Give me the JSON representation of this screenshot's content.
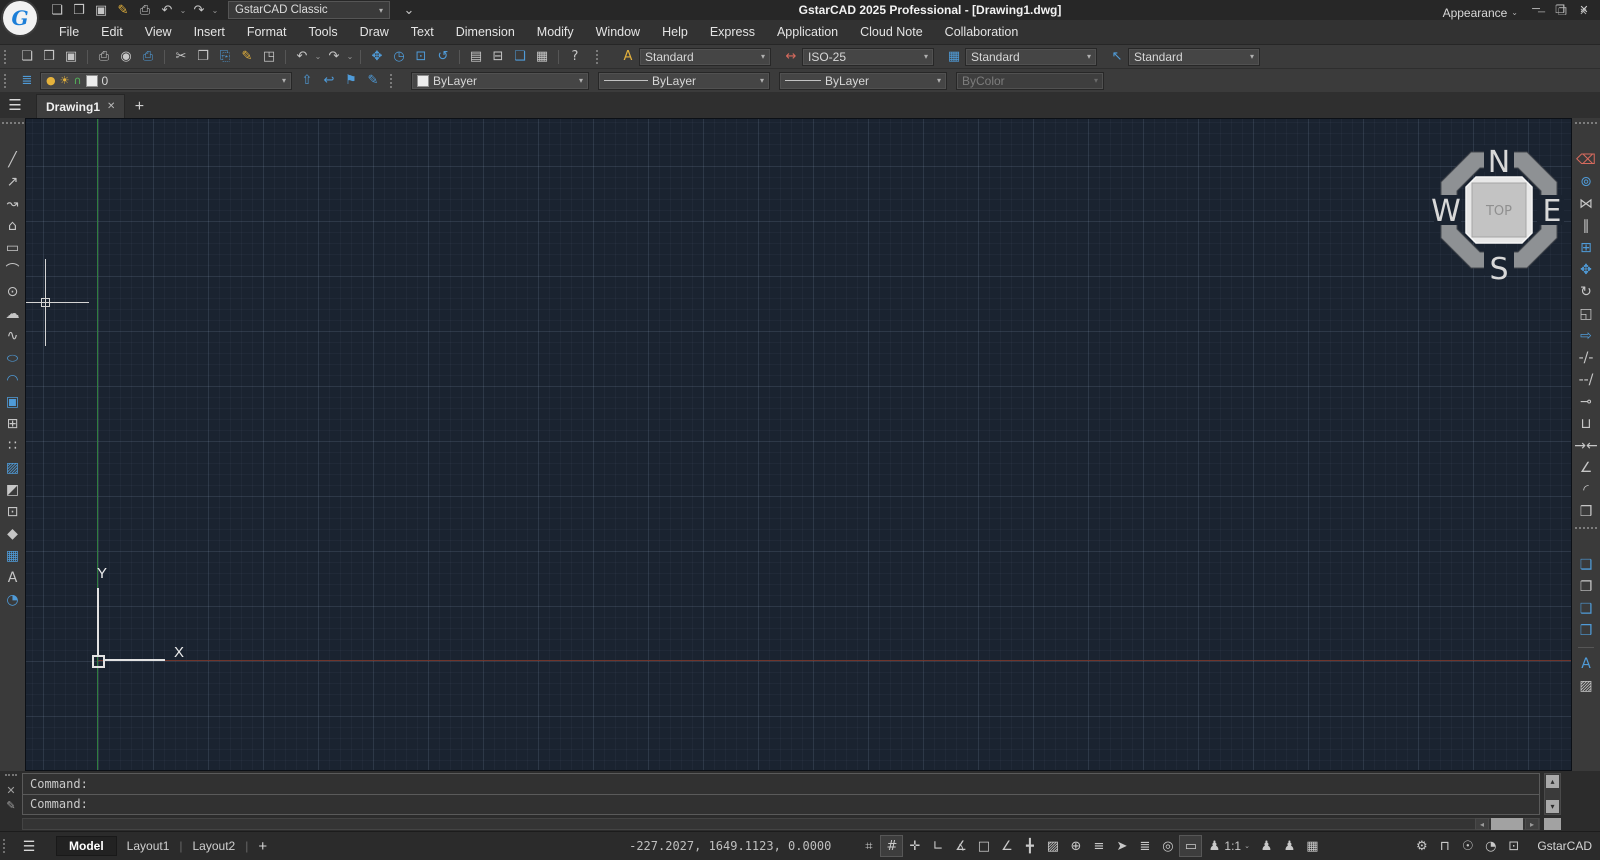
{
  "ui": {
    "caret": "▾",
    "caret_small": "⌄",
    "pipe": "|",
    "close": "✕",
    "add": "+",
    "hamburger": "☰",
    "left_arrow": "◂",
    "right_arrow": "▸",
    "up_arrow": "▴",
    "down_arrow": "▾"
  },
  "window": {
    "logo": "G",
    "title": "GstarCAD 2025 Professional - [Drawing1.dwg]",
    "controls": {
      "minimize": "─",
      "restore": "❐",
      "close": "✕"
    }
  },
  "quick_access": {
    "icons": [
      {
        "name": "new-file-icon",
        "glyph": "❏"
      },
      {
        "name": "open-file-icon",
        "glyph": "❒"
      },
      {
        "name": "save-icon",
        "glyph": "▣"
      },
      {
        "name": "save-as-icon",
        "glyph": "✎",
        "cls": "c-y"
      },
      {
        "name": "print-icon",
        "glyph": "⎙"
      },
      {
        "name": "undo-icon",
        "glyph": "↶"
      },
      {
        "name": "undo-dropdown-icon",
        "glyph": "⌄",
        "cls": "caret-ico"
      },
      {
        "name": "redo-icon",
        "glyph": "↷"
      },
      {
        "name": "redo-dropdown-icon",
        "glyph": "⌄",
        "cls": "caret-ico"
      }
    ],
    "workspace": "GstarCAD Classic",
    "overflow_glyph": "⌄"
  },
  "menu": {
    "items": [
      {
        "name": "menu-file",
        "label": "File"
      },
      {
        "name": "menu-edit",
        "label": "Edit"
      },
      {
        "name": "menu-view",
        "label": "View"
      },
      {
        "name": "menu-insert",
        "label": "Insert"
      },
      {
        "name": "menu-format",
        "label": "Format"
      },
      {
        "name": "menu-tools",
        "label": "Tools"
      },
      {
        "name": "menu-draw",
        "label": "Draw"
      },
      {
        "name": "menu-text",
        "label": "Text"
      },
      {
        "name": "menu-dimension",
        "label": "Dimension"
      },
      {
        "name": "menu-modify",
        "label": "Modify"
      },
      {
        "name": "menu-window",
        "label": "Window"
      },
      {
        "name": "menu-help",
        "label": "Help"
      },
      {
        "name": "menu-express",
        "label": "Express"
      },
      {
        "name": "menu-application",
        "label": "Application"
      },
      {
        "name": "menu-cloud-note",
        "label": "Cloud Note"
      },
      {
        "name": "menu-collaboration",
        "label": "Collaboration"
      }
    ],
    "appearance": "Appearance"
  },
  "toolbar_standard": {
    "icons": [
      {
        "name": "new-file-icon",
        "glyph": "❏"
      },
      {
        "name": "open-file-icon",
        "glyph": "❒"
      },
      {
        "name": "save-icon",
        "glyph": "▣"
      },
      {
        "name": "print-icon",
        "glyph": "⎙",
        "cls": "sb"
      },
      {
        "name": "print-preview-icon",
        "glyph": "◉"
      },
      {
        "name": "plot-icon",
        "glyph": "⎙",
        "cls": "c-b"
      },
      {
        "name": "cut-icon",
        "glyph": "✂",
        "cls": "sb"
      },
      {
        "name": "copy-icon",
        "glyph": "❐"
      },
      {
        "name": "paste-icon",
        "glyph": "⎘",
        "cls": "c-b"
      },
      {
        "name": "match-properties-icon",
        "glyph": "✎",
        "cls": "c-y"
      },
      {
        "name": "block-editor-icon",
        "glyph": "◳"
      },
      {
        "name": "undo-icon",
        "glyph": "↶",
        "cls": "sb"
      },
      {
        "name": "undo-dropdown-icon",
        "glyph": "⌄",
        "cls": "caret-ico"
      },
      {
        "name": "redo-icon",
        "glyph": "↷"
      },
      {
        "name": "redo-dropdown-icon",
        "glyph": "⌄",
        "cls": "caret-ico"
      },
      {
        "name": "pan-icon",
        "glyph": "✥",
        "cls": "sb c-b"
      },
      {
        "name": "zoom-realtime-icon",
        "glyph": "◷",
        "cls": "c-b"
      },
      {
        "name": "zoom-window-icon",
        "glyph": "⊡",
        "cls": "c-b"
      },
      {
        "name": "zoom-previous-icon",
        "glyph": "↺",
        "cls": "c-b"
      },
      {
        "name": "properties-palette-icon",
        "glyph": "▤",
        "cls": "sb"
      },
      {
        "name": "design-center-icon",
        "glyph": "⊟"
      },
      {
        "name": "toolbox-icon",
        "glyph": "❑",
        "cls": "c-b"
      },
      {
        "name": "calculator-icon",
        "glyph": "▦"
      },
      {
        "name": "help-icon",
        "glyph": "?",
        "cls": "sb"
      }
    ]
  },
  "style_combos": {
    "combos": [
      {
        "name": "text-style-combo",
        "icon": "A",
        "icls": "c-y",
        "value": "Standard"
      },
      {
        "name": "dimension-style-combo",
        "icon": "↔",
        "icls": "c-r",
        "value": "ISO-25"
      },
      {
        "name": "table-style-combo",
        "icon": "▦",
        "icls": "c-b",
        "value": "Standard"
      },
      {
        "name": "multileader-style-combo",
        "icon": "↖",
        "icls": "c-b",
        "value": "Standard"
      }
    ]
  },
  "layers": {
    "panel_icon": "≣",
    "bulb": "●",
    "sun": "☀",
    "lock": "∩",
    "current": "0",
    "tools": [
      {
        "name": "make-object-layer-current-icon",
        "glyph": "⇧",
        "cls": "c-b"
      },
      {
        "name": "layer-previous-icon",
        "glyph": "↩",
        "cls": "c-b"
      },
      {
        "name": "layer-states-icon",
        "glyph": "⚑",
        "cls": "c-b"
      },
      {
        "name": "change-to-current-layer-icon",
        "glyph": "✎",
        "cls": "c-b"
      }
    ]
  },
  "properties_toolbar": {
    "color_value": "ByLayer",
    "linetype_value": "ByLayer",
    "lineweight_value": "ByLayer",
    "plotstyle_value": "ByColor"
  },
  "tab_bar": {
    "tabs": [
      {
        "name": "tab-drawing1",
        "label": "Drawing1"
      }
    ]
  },
  "draw_toolbar": {
    "icons": [
      {
        "name": "toolbar-grip",
        "glyph": "",
        "cls": "vgrip"
      },
      {
        "name": "line-icon",
        "glyph": "╱"
      },
      {
        "name": "construction-line-icon",
        "glyph": "↗"
      },
      {
        "name": "polyline-icon",
        "glyph": "↝"
      },
      {
        "name": "polygon-icon",
        "glyph": "⌂"
      },
      {
        "name": "rectangle-icon",
        "glyph": "▭"
      },
      {
        "name": "arc-icon",
        "glyph": "⌒"
      },
      {
        "name": "circle-icon",
        "glyph": "⊙"
      },
      {
        "name": "revision-cloud-icon",
        "glyph": "☁"
      },
      {
        "name": "spline-icon",
        "glyph": "∿"
      },
      {
        "name": "ellipse-icon",
        "glyph": "○",
        "cls": "c-b flat"
      },
      {
        "name": "ellipse-arc-icon",
        "glyph": "◠",
        "cls": "c-b"
      },
      {
        "name": "insert-block-icon",
        "glyph": "▣",
        "cls": "c-b"
      },
      {
        "name": "make-block-icon",
        "glyph": "⊞"
      },
      {
        "name": "point-icon",
        "glyph": "∷"
      },
      {
        "name": "hatch-icon",
        "glyph": "▨",
        "cls": "c-b"
      },
      {
        "name": "gradient-icon",
        "glyph": "◩"
      },
      {
        "name": "region-icon",
        "glyph": "⊡"
      },
      {
        "name": "wipeout-icon",
        "glyph": "◆"
      },
      {
        "name": "table-icon",
        "glyph": "▦",
        "cls": "c-b"
      },
      {
        "name": "multiline-text-icon",
        "glyph": "A"
      },
      {
        "name": "divide-icon",
        "glyph": "◔",
        "cls": "c-b"
      }
    ]
  },
  "modify_toolbar": {
    "icons": [
      {
        "name": "toolbar-grip",
        "glyph": "",
        "cls": "vgrip"
      },
      {
        "name": "erase-icon",
        "glyph": "⌫",
        "cls": "c-r"
      },
      {
        "name": "copy-object-icon",
        "glyph": "⊚",
        "cls": "c-b"
      },
      {
        "name": "mirror-icon",
        "glyph": "⋈"
      },
      {
        "name": "offset-icon",
        "glyph": "∥"
      },
      {
        "name": "array-icon",
        "glyph": "⊞",
        "cls": "c-b"
      },
      {
        "name": "move-icon",
        "glyph": "✥",
        "cls": "c-b"
      },
      {
        "name": "rotate-icon",
        "glyph": "↻"
      },
      {
        "name": "scale-icon",
        "glyph": "◱"
      },
      {
        "name": "stretch-icon",
        "glyph": "⇨",
        "cls": "c-b"
      },
      {
        "name": "trim-icon",
        "glyph": "-/-"
      },
      {
        "name": "extend-icon",
        "glyph": "--/"
      },
      {
        "name": "break-at-point-icon",
        "glyph": "⊸"
      },
      {
        "name": "break-icon",
        "glyph": "⊔"
      },
      {
        "name": "join-icon",
        "glyph": "→←"
      },
      {
        "name": "chamfer-icon",
        "glyph": "∠"
      },
      {
        "name": "fillet-icon",
        "glyph": "◜"
      },
      {
        "name": "explode-icon",
        "glyph": "❒"
      },
      {
        "name": "toolbar-grip",
        "glyph": "",
        "cls": "vgrip"
      },
      {
        "name": "bring-to-front-icon",
        "glyph": "❏",
        "cls": "c-b"
      },
      {
        "name": "send-to-back-icon",
        "glyph": "❐"
      },
      {
        "name": "bring-above-objects-icon",
        "glyph": "❑",
        "cls": "c-b"
      },
      {
        "name": "send-under-objects-icon",
        "glyph": "❒",
        "cls": "c-b"
      },
      {
        "name": "text-to-front-icon",
        "glyph": "A",
        "cls": "st c-b"
      },
      {
        "name": "hatch-to-back-icon",
        "glyph": "▨"
      }
    ]
  },
  "canvas": {
    "compass": {
      "n": "N",
      "e": "E",
      "s": "S",
      "w": "W",
      "top": "TOP"
    },
    "ucs": {
      "x_label": "X",
      "y_label": "Y"
    },
    "colors": {
      "background": "#1a2330",
      "x_axis": "#6e352c",
      "y_axis": "#2f7d3f"
    }
  },
  "command": {
    "history": "Command:",
    "input": "Command:"
  },
  "status_bar": {
    "model_tab": "Model",
    "layouts": [
      {
        "name": "layout1-tab",
        "label": "Layout1"
      },
      {
        "name": "layout2-tab",
        "label": "Layout2"
      }
    ],
    "coordinates": "-227.2027, 1649.1123, 0.0000",
    "toggle_icons": [
      {
        "name": "snap-mode-icon",
        "glyph": "⌗"
      },
      {
        "name": "grid-display-icon",
        "glyph": "#",
        "cls": "pressed"
      },
      {
        "name": "entity-snap-icon",
        "glyph": "✛"
      },
      {
        "name": "ortho-mode-icon",
        "glyph": "∟"
      },
      {
        "name": "polar-tracking-icon",
        "glyph": "∡"
      },
      {
        "name": "object-snap-icon",
        "glyph": "□"
      },
      {
        "name": "object-snap-tracking-icon",
        "glyph": "∠"
      },
      {
        "name": "dynamic-ucs-icon",
        "glyph": "╋"
      },
      {
        "name": "show-hatch-icon",
        "glyph": "▨"
      },
      {
        "name": "dynamic-input-icon",
        "glyph": "⊕"
      },
      {
        "name": "show-lineweight-icon",
        "glyph": "≡",
        "cls": "c-b"
      },
      {
        "name": "selection-cycling-icon",
        "glyph": "➤"
      },
      {
        "name": "isolate-objects-icon",
        "glyph": "≣"
      },
      {
        "name": "quick-zoom-icon",
        "glyph": "◎",
        "cls": "c-b"
      },
      {
        "name": "workspace-switch-icon",
        "glyph": "▭",
        "cls": "pressed c-b"
      }
    ],
    "annotation_scale": "1:1",
    "annotation_person_glyph": "♟",
    "annotation_icons": [
      {
        "name": "annotation-visibility-icon",
        "glyph": "♟",
        "cls": "c-y"
      },
      {
        "name": "auto-annotation-icon",
        "glyph": "♟",
        "cls": "dim"
      },
      {
        "name": "quick-properties-icon",
        "glyph": "▦"
      }
    ],
    "system_icons": [
      {
        "name": "settings-icon",
        "glyph": "⚙",
        "cls": "c-y"
      },
      {
        "name": "interface-lock-icon",
        "glyph": "⊓",
        "cls": "c-b"
      },
      {
        "name": "hardware-acceleration-icon",
        "glyph": "☉",
        "cls": "c-y"
      },
      {
        "name": "performance-icon",
        "glyph": "◔"
      },
      {
        "name": "full-screen-icon",
        "glyph": "⊡"
      }
    ],
    "brand": "GstarCAD"
  }
}
